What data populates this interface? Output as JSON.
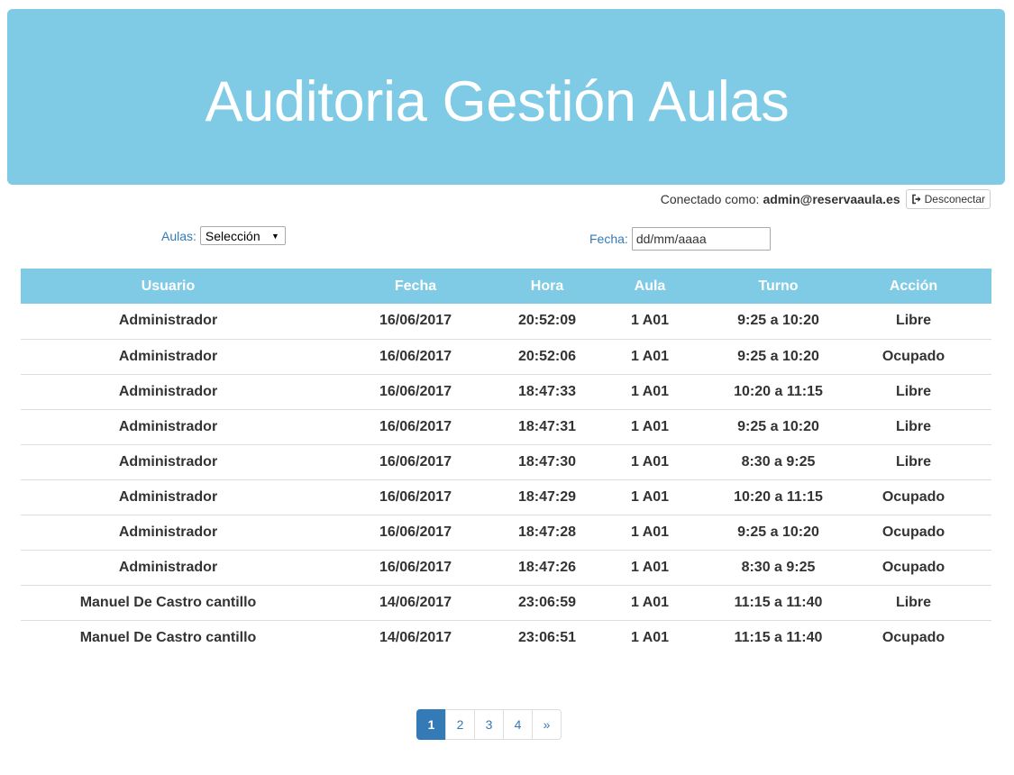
{
  "header": {
    "title": "Auditoria Gestión Aulas"
  },
  "userbar": {
    "connected_label": "Conectado como:",
    "user_email": "admin@reservaaula.es",
    "logout_label": "Desconectar",
    "logout_icon": "sign-out-icon"
  },
  "filters": {
    "aulas_label": "Aulas:",
    "aulas_selected": "Selección",
    "fecha_label": "Fecha:",
    "fecha_placeholder": "dd/mm/aaaa"
  },
  "table": {
    "columns": [
      "Usuario",
      "Fecha",
      "Hora",
      "Aula",
      "Turno",
      "Acción"
    ],
    "rows": [
      [
        "Administrador",
        "16/06/2017",
        "20:52:09",
        "1 A01",
        "9:25 a 10:20",
        "Libre"
      ],
      [
        "Administrador",
        "16/06/2017",
        "20:52:06",
        "1 A01",
        "9:25 a 10:20",
        "Ocupado"
      ],
      [
        "Administrador",
        "16/06/2017",
        "18:47:33",
        "1 A01",
        "10:20 a 11:15",
        "Libre"
      ],
      [
        "Administrador",
        "16/06/2017",
        "18:47:31",
        "1 A01",
        "9:25 a 10:20",
        "Libre"
      ],
      [
        "Administrador",
        "16/06/2017",
        "18:47:30",
        "1 A01",
        "8:30 a 9:25",
        "Libre"
      ],
      [
        "Administrador",
        "16/06/2017",
        "18:47:29",
        "1 A01",
        "10:20 a 11:15",
        "Ocupado"
      ],
      [
        "Administrador",
        "16/06/2017",
        "18:47:28",
        "1 A01",
        "9:25 a 10:20",
        "Ocupado"
      ],
      [
        "Administrador",
        "16/06/2017",
        "18:47:26",
        "1 A01",
        "8:30 a 9:25",
        "Ocupado"
      ],
      [
        "Manuel De Castro cantillo",
        "14/06/2017",
        "23:06:59",
        "1 A01",
        "11:15 a 11:40",
        "Libre"
      ],
      [
        "Manuel De Castro cantillo",
        "14/06/2017",
        "23:06:51",
        "1 A01",
        "11:15 a 11:40",
        "Ocupado"
      ]
    ]
  },
  "pagination": {
    "pages": [
      "1",
      "2",
      "3",
      "4",
      "»"
    ],
    "active_index": 0
  },
  "colors": {
    "header_bg": "#7fcbe6",
    "link": "#337ab7",
    "active_page": "#337ab7"
  }
}
